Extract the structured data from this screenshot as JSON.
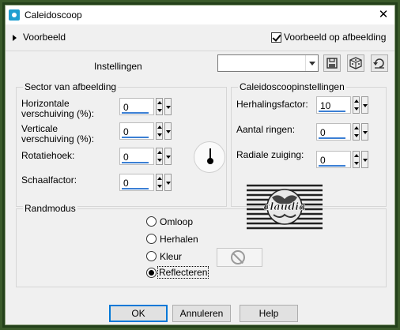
{
  "window": {
    "title": "Caleidoscoop",
    "icon": "camera-app-icon",
    "close_glyph": "✕"
  },
  "preview": {
    "label": "Voorbeeld",
    "preview_on_image_label": "Voorbeeld op afbeelding",
    "preview_on_image_checked": true
  },
  "settings": {
    "label": "Instellingen",
    "preset_value": ""
  },
  "sector": {
    "title": "Sector van afbeelding",
    "horizontal_offset_label": "Horizontale verschuiving (%):",
    "horizontal_offset_value": "0",
    "vertical_offset_label": "Verticale verschuiving (%):",
    "vertical_offset_value": "0",
    "rotation_label": "Rotatiehoek:",
    "rotation_value": "0",
    "scale_label": "Schaalfactor:",
    "scale_value": "0"
  },
  "kaleido": {
    "title": "Caleidoscoopinstellingen",
    "repeat_label": "Herhalingsfactor:",
    "repeat_value": "10",
    "rings_label": "Aantal ringen:",
    "rings_value": "0",
    "radial_label": "Radiale zuiging:",
    "radial_value": "0"
  },
  "edge_mode": {
    "title": "Randmodus",
    "options": [
      "Omloop",
      "Herhalen",
      "Kleur",
      "Reflecteren"
    ],
    "selected": "Reflecteren"
  },
  "watermark": {
    "text": "claudia"
  },
  "buttons": {
    "ok": "OK",
    "cancel": "Annuleren",
    "help": "Help"
  },
  "colors": {
    "accent": "#0078d7",
    "frame": "#2f4a22",
    "value_underline": "#3b7fd4"
  }
}
